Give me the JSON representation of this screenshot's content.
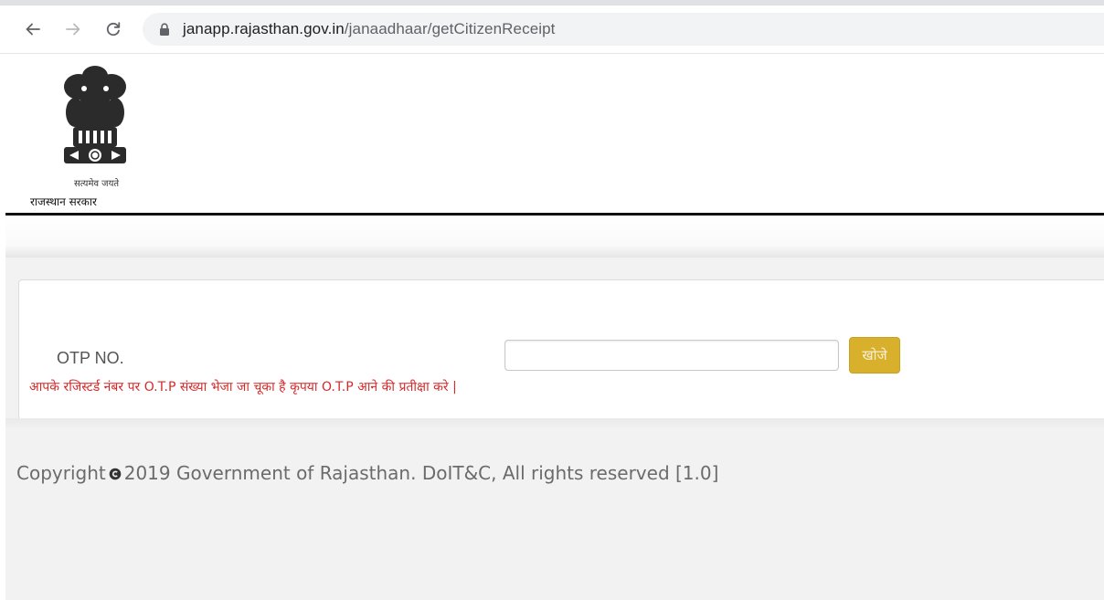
{
  "browser": {
    "url_host": "janapp.rajasthan.gov.in",
    "url_path": "/janaadhaar/getCitizenReceipt"
  },
  "header": {
    "emblem_motto": "सत्यमेव जयते",
    "gov_name": "राजस्थान सरकार"
  },
  "form": {
    "otp_label": "OTP NO.",
    "otp_value": "",
    "otp_placeholder": "",
    "search_label": "खोजे",
    "otp_message": "आपके रजिस्टर्ड नंबर पर O.T.P संख्या भेजा जा चूका है कृपया O.T.P आने की प्रतीक्षा करे |",
    "message_color": "#d42a2a",
    "button_color": "#d9b02b"
  },
  "footer": {
    "copyright_prefix": "Copyright",
    "copyright_suffix": "2019 Government of Rajasthan. DoIT&C, All rights reserved [1.0]"
  }
}
